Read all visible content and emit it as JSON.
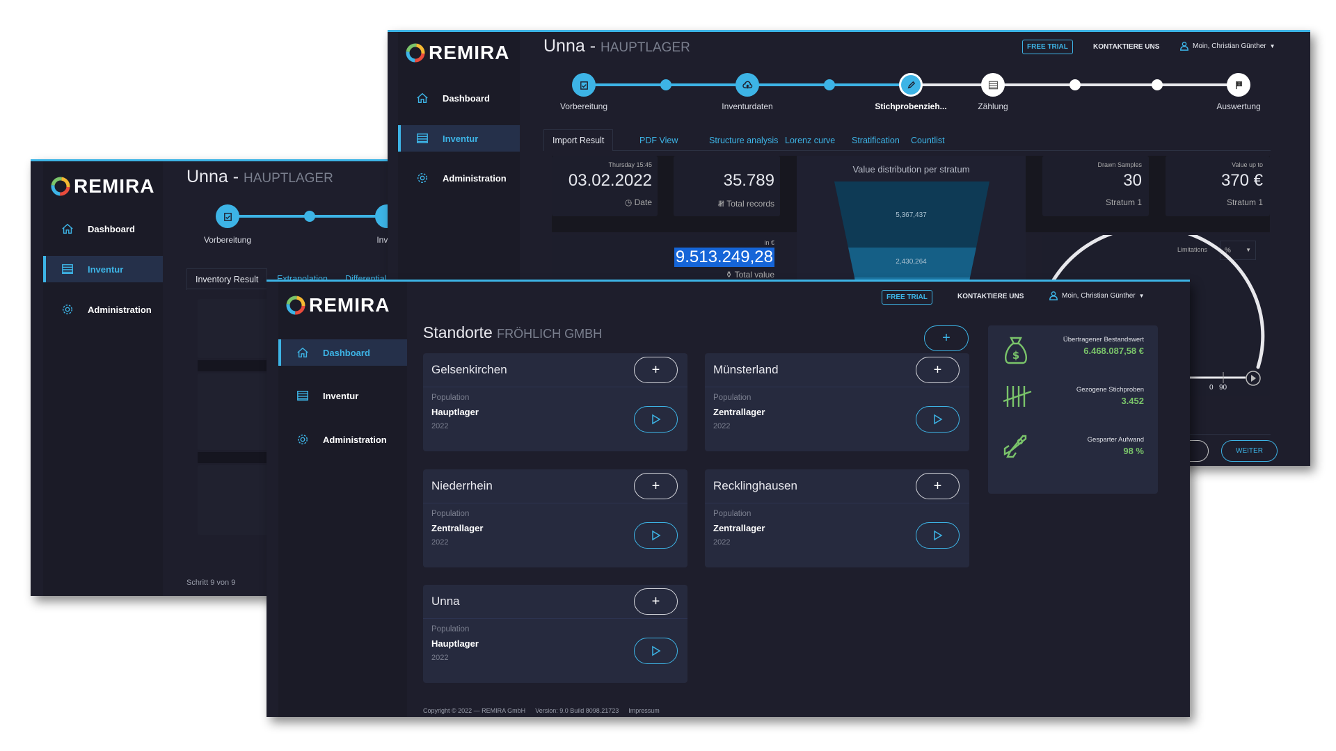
{
  "brand": "REMIRA",
  "nav": {
    "dashboard": "Dashboard",
    "inventur": "Inventur",
    "administration": "Administration"
  },
  "header": {
    "free_trial": "FREE TRIAL",
    "contact": "KONTAKTIERE UNS",
    "user": "Moin, Christian Günther"
  },
  "back_window": {
    "title": "Unna -",
    "subtitle": "HAUPTLAGER",
    "steps": [
      "Vorbereitung",
      "Inven"
    ],
    "tabs": [
      "Inventory Result",
      "Extrapolation",
      "Differential"
    ],
    "step_info": "Schritt 9 von 9"
  },
  "wizard_window": {
    "title": "Unna -",
    "subtitle": "HAUPTLAGER",
    "steps": [
      {
        "label": "Vorbereitung",
        "state": "done"
      },
      {
        "label": "Inventurdaten",
        "state": "done"
      },
      {
        "label": "Stichprobenzieh...",
        "state": "active"
      },
      {
        "label": "Zählung",
        "state": "todo"
      },
      {
        "label": "Auswertung",
        "state": "todo"
      }
    ],
    "tabs": [
      "Import Result",
      "PDF View",
      "Structure analysis",
      "Lorenz curve",
      "Stratification",
      "Countlist"
    ],
    "date_card": {
      "caption": "Thursday 15:45",
      "value": "03.02.2022",
      "label": "Date"
    },
    "records_card": {
      "value": "35.789",
      "label": "Total records"
    },
    "value_card": {
      "unit": "in €",
      "value": "9.513.249,28",
      "label": "Total value"
    },
    "funnel": {
      "title": "Value distribution per stratum",
      "values": [
        "5,367,437",
        "2,430,264"
      ]
    },
    "drawn_card": {
      "caption": "Drawn Samples",
      "value": "30",
      "label": "Stratum 1"
    },
    "upto_card": {
      "caption": "Value up to",
      "value": "370 €",
      "label": "Stratum 1"
    },
    "limitations": {
      "label": "Limitations",
      "select": "%",
      "tick_partial": "0",
      "tick": "90"
    },
    "next_button": "WEITER"
  },
  "locations_window": {
    "title": "Standorte",
    "subtitle": "FRÖHLICH GMBH",
    "population_label": "Population",
    "locations": [
      {
        "name": "Gelsenkirchen",
        "population": "Hauptlager",
        "year": "2022"
      },
      {
        "name": "Münsterland",
        "population": "Zentrallager",
        "year": "2022"
      },
      {
        "name": "Niederrhein",
        "population": "Zentrallager",
        "year": "2022"
      },
      {
        "name": "Recklinghausen",
        "population": "Zentrallager",
        "year": "2022"
      },
      {
        "name": "Unna",
        "population": "Hauptlager",
        "year": "2022"
      }
    ],
    "stats": [
      {
        "label": "Übertragener Bestandswert",
        "value": "6.468.087,58 €",
        "icon": "money-bag-icon"
      },
      {
        "label": "Gezogene Stichproben",
        "value": "3.452",
        "icon": "tally-icon"
      },
      {
        "label": "Gesparter Aufwand",
        "value": "98 %",
        "icon": "rocket-icon"
      }
    ],
    "footer": {
      "copyright": "Copyright © 2022 — REMIRA GmbH",
      "version": "Version: 9.0 Build 8098.21723",
      "impressum": "Impressum"
    }
  },
  "colors": {
    "accent": "#3db4e6",
    "green": "#7ac46a",
    "bg": "#1e1e2c"
  }
}
